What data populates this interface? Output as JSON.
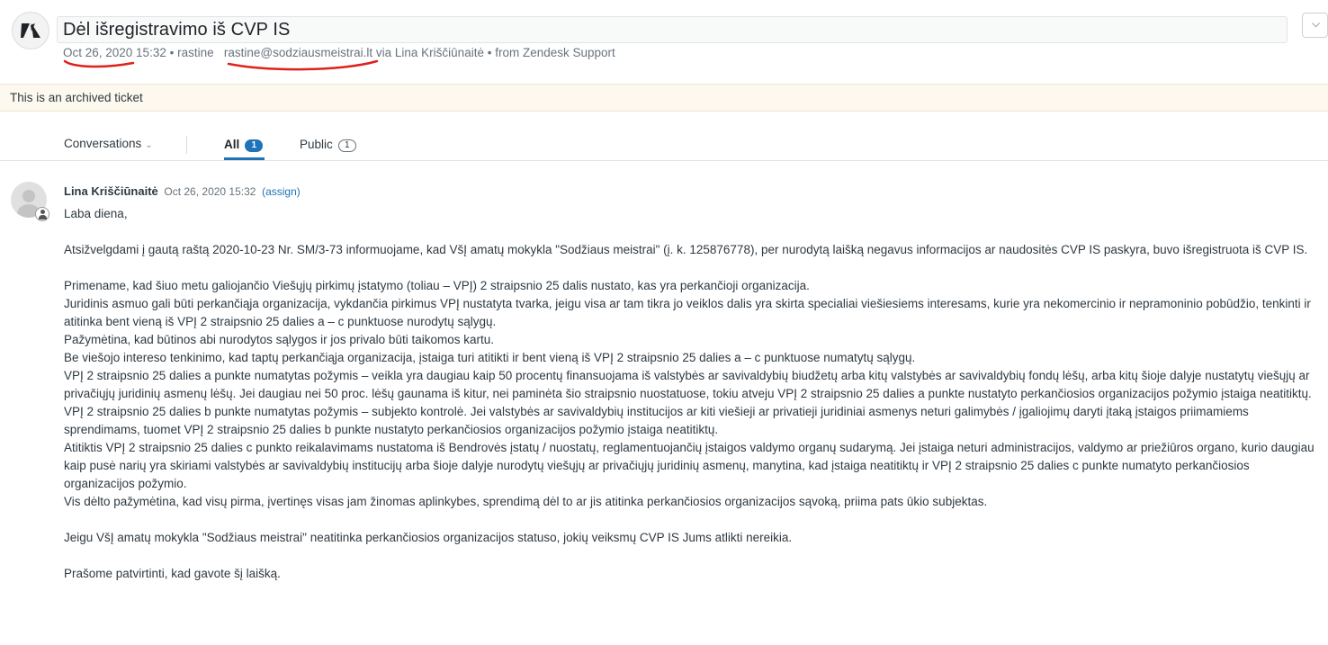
{
  "ticket": {
    "subject": "Dėl išregistravimo iš CVP IS",
    "meta": {
      "date": "Oct 26, 2020 15:32",
      "sep1": " • ",
      "requester": "rastine",
      "email": "rastine@sodziausmeistrai.lt",
      "via": " via Lina Kriščiūnaitė",
      "sep2": " • ",
      "source": "from Zendesk Support"
    },
    "archived_notice": "This is an archived ticket",
    "dropdown_icon": "chevron-down-icon"
  },
  "tabs": {
    "filter_label": "Conversations",
    "all_label": "All",
    "all_count": "1",
    "public_label": "Public",
    "public_count": "1"
  },
  "message": {
    "author": "Lina Kriščiūnaitė",
    "time": "Oct 26, 2020 15:32",
    "assign": "(assign)",
    "paragraphs": [
      "Laba diena,",
      "",
      "Atsižvelgdami į gautą raštą 2020-10-23 Nr. SM/3-73 informuojame, kad  VšĮ amatų mokykla \"Sodžiaus meistrai\"  (į. k. 125876778), per nurodytą laišką negavus  informacijos ar naudositės CVP IS paskyra, buvo išregistruota iš CVP IS.",
      "",
      "Primename, kad šiuo metu galiojančio Viešųjų pirkimų įstatymo (toliau – VPĮ) 2 straipsnio 25 dalis nustato, kas yra perkančioji organizacija.",
      "Juridinis asmuo gali būti  perkančiąja organizacija, vykdančia pirkimus VPĮ nustatyta tvarka, jeigu visa ar tam tikra jo veiklos dalis yra skirta specialiai viešiesiems interesams, kurie yra nekomercinio ir nepramoninio pobūdžio, tenkinti ir atitinka bent vieną iš VPĮ 2 straipsnio 25 dalies a – c punktuose nurodytų sąlygų.",
      "Pažymėtina, kad būtinos abi nurodytos sąlygos ir jos privalo būti taikomos kartu.",
      "Be viešojo intereso tenkinimo, kad taptų perkančiąja organizacija, įstaiga turi atitikti ir bent vieną iš VPĮ 2 straipsnio 25 dalies a – c punktuose numatytų sąlygų.",
      "VPĮ 2 straipsnio 25 dalies a punkte numatytas požymis – veikla yra daugiau kaip 50 procentų finansuojama iš valstybės ar savivaldybių biudžetų arba kitų valstybės ar savivaldybių fondų lėšų, arba kitų šioje dalyje nustatytų viešųjų ar privačiųjų juridinių asmenų lėšų. Jei daugiau nei 50 proc. lėšų gaunama iš kitur, nei paminėta šio straipsnio nuostatuose, tokiu atveju VPĮ 2 straipsnio 25 dalies a punkte nustatyto perkančiosios organizacijos požymio įstaiga neatitiktų.",
      "VPĮ 2 straipsnio 25 dalies b punkte numatytas požymis – subjekto kontrolė. Jei valstybės ar savivaldybių institucijos ar kiti viešieji ar privatieji juridiniai asmenys neturi galimybės / įgaliojimų daryti įtaką įstaigos priimamiems sprendimams, tuomet VPĮ 2 straipsnio 25 dalies b punkte nustatyto perkančiosios organizacijos požymio įstaiga neatitiktų.",
      "Atitiktis VPĮ 2 straipsnio 25 dalies c punkto reikalavimams nustatoma iš Bendrovės įstatų / nuostatų, reglamentuojančių įstaigos valdymo organų sudarymą. Jei įstaiga neturi administracijos, valdymo ar priežiūros organo, kurio daugiau kaip pusė narių yra skiriami valstybės ar savivaldybių institucijų arba šioje dalyje nurodytų viešųjų ar privačiųjų juridinių asmenų, manytina, kad įstaiga neatitiktų ir VPĮ 2 straipsnio 25 dalies c punkte numatyto perkančiosios organizacijos požymio.",
      "Vis dėlto pažymėtina, kad visų pirma, įvertinęs visas jam žinomas aplinkybes, sprendimą dėl to ar jis atitinka perkančiosios organizacijos sąvoką, priima pats ūkio subjektas.",
      "",
      "Jeigu VšĮ amatų mokykla \"Sodžiaus meistrai\" neatitinka perkančiosios organizacijos statuso, jokių veiksmų CVP IS Jums atlikti nereikia.",
      "",
      "Prašome patvirtinti, kad gavote šį laišką."
    ]
  },
  "colors": {
    "accent": "#1f73b7",
    "annotation_red": "#e0201b",
    "archived_bg": "#fdf9ee"
  }
}
